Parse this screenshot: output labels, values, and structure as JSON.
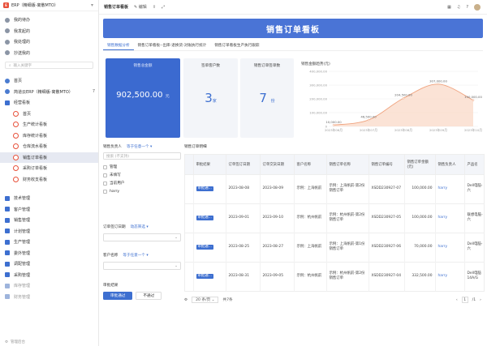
{
  "app": {
    "title": "ERP（精细版-离散MTO）",
    "logo_text": "E"
  },
  "sidebar": {
    "quick": [
      {
        "label": "我的待办",
        "icon": "todo-icon"
      },
      {
        "label": "我发起的",
        "icon": "send-icon"
      },
      {
        "label": "我处理的",
        "icon": "check-icon"
      },
      {
        "label": "抄送我的",
        "icon": "cc-icon"
      }
    ],
    "search_placeholder": "输入关键字",
    "top_items": [
      {
        "label": "首页",
        "icon": "home-icon"
      },
      {
        "label": "简道云ERP（精细版-离散MTO）",
        "icon": "app-icon",
        "count": "7"
      },
      {
        "label": "经营看板",
        "icon": "folder-icon"
      }
    ],
    "board_items": [
      {
        "label": "首页"
      },
      {
        "label": "生产统计看板"
      },
      {
        "label": "库存统计看板"
      },
      {
        "label": "仓库流水看板"
      },
      {
        "label": "销售订单看板"
      },
      {
        "label": "采购订单看板"
      },
      {
        "label": "财务收支看板"
      }
    ],
    "modules": [
      {
        "label": "技术管理"
      },
      {
        "label": "客户管理"
      },
      {
        "label": "销售管理"
      },
      {
        "label": "计划管理"
      },
      {
        "label": "生产管理"
      },
      {
        "label": "委外管理"
      },
      {
        "label": "调配管理"
      },
      {
        "label": "采购管理"
      },
      {
        "label": "库存管理"
      },
      {
        "label": "财务管理"
      }
    ],
    "footer": "管理后台"
  },
  "topbar": {
    "page": "销售订单看板",
    "edit": "编辑",
    "icons": [
      "share-icon",
      "fullscreen-icon"
    ]
  },
  "banner": {
    "title": "销售订单看板"
  },
  "tabs": [
    "销售数据分析",
    "销售订单看板--出库-退换货-对账执行统计",
    "销售订单看板生产执行跟踪"
  ],
  "kpis": [
    {
      "label": "销售总金额",
      "value": "902,500.00",
      "unit": "元"
    },
    {
      "label": "签单客户数",
      "value": "3",
      "unit": "家"
    },
    {
      "label": "销售订单签单数",
      "value": "7",
      "unit": "份"
    }
  ],
  "trend": {
    "label": "销售金额趋势(元)",
    "colors": {
      "line": "#f0a37e",
      "area": "#f9d7c4",
      "axis": "#999999"
    }
  },
  "chart_data": {
    "type": "area",
    "title": "销售金额趋势(元)",
    "x": [
      "2023年06月",
      "2023年07月",
      "2023年08月",
      "2023年09月",
      "2023年10月"
    ],
    "values": [
      10000,
      46500,
      204500,
      307000,
      190000
    ],
    "data_labels": [
      "10,000.00",
      "46,500.00",
      "204,500.00",
      "307,000.00",
      "190,000.00"
    ],
    "yticks": [
      "400,000.00",
      "300,000.00",
      "200,000.00",
      "100,000.00",
      "0"
    ],
    "ylim": [
      0,
      400000
    ],
    "grid": true
  },
  "filters": {
    "owner": {
      "label": "销售负责人",
      "mode": "等于任意一个",
      "placeholder": "搜索 (不支持)",
      "options": [
        "管理",
        "未填写",
        "当前用户",
        "harry"
      ]
    },
    "date": {
      "label": "订单签订日期",
      "mode": "动态筛选"
    },
    "customer": {
      "label": "客户名称",
      "mode": "等于任意一个"
    },
    "approval": {
      "label": "审批结果",
      "approve": "审批通过",
      "reject": "不通过"
    }
  },
  "table": {
    "title": "销售订单明细",
    "headers": [
      "审批结果",
      "订单签订日期",
      "订单交货日期",
      "客户名称",
      "销售订单名称",
      "销售订单编号",
      "销售订单金额(元)",
      "销售负责人",
      "产品名"
    ],
    "rows": [
      [
        "审批通...",
        "2023-08-08",
        "2023-08-09",
        "示例：上海帆前",
        "示例：上海帆前-第2份销售订单",
        "XSDD230927-07",
        "100,000.00",
        "harry",
        "Dell电脑-六"
      ],
      [
        "审批通...",
        "2023-09-01",
        "2023-09-10",
        "示例：杭州帆前",
        "示例：杭州帆前-第2份销售订单",
        "XSDD230927-05",
        "100,000.00",
        "harry",
        "联想电脑-六"
      ],
      [
        "审批通...",
        "2023-08-25",
        "2023-08-27",
        "示例：上海帆前",
        "示例：上海帆前-第1份销售订单",
        "XSDD230927-06",
        "70,000.00",
        "harry",
        "Dell电脑-六"
      ],
      [
        "审批通...",
        "2023-08-31",
        "2023-09-05",
        "示例：杭州帆前",
        "示例：杭州帆前-第2份销售订单",
        "XSDD230927-04",
        "332,500.00",
        "harry",
        "Dell电脑 14A/G"
      ],
      [
        "审批通...",
        "2023-07-05",
        "2023-07-20",
        "示例：无锡简道云",
        "示例：无锡简道云-第1份销售订单",
        "XSDD230927-03",
        "204,000.00",
        "harry",
        "Dell电脑 联想电脑"
      ]
    ]
  },
  "pager": {
    "page_size": "20 条/页",
    "total": "共7条",
    "current": "1",
    "pages": "/1"
  }
}
